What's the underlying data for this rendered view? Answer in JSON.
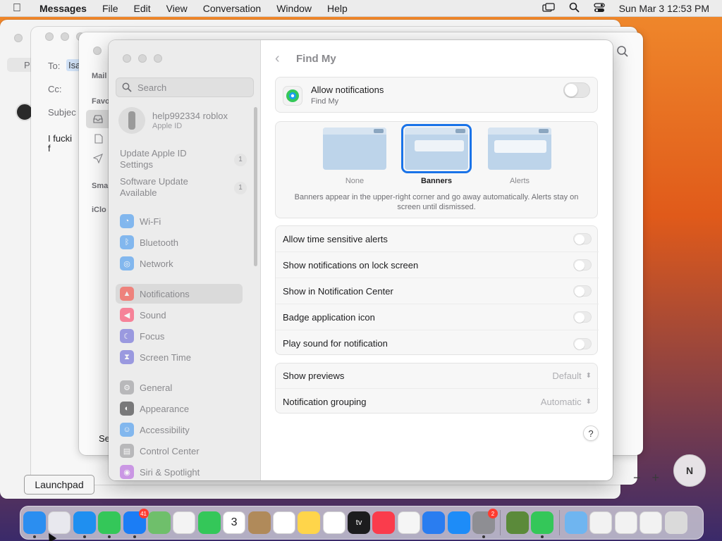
{
  "menubar": {
    "app_name": "Messages",
    "items": [
      "File",
      "Edit",
      "View",
      "Conversation",
      "Window",
      "Help"
    ],
    "clock": "Sun Mar 3  12:53 PM"
  },
  "background_messages": {
    "to_label": "To:",
    "to_value": "Isa",
    "cc_label": "Cc:",
    "subject_label": "Subjec",
    "body_text": "I fucki\nf",
    "mail_label": "Mail",
    "favorites_label": "Favo",
    "smart_label": "Sma",
    "icloud_label": "iClo",
    "send_label": "Se",
    "p_label": "P"
  },
  "sidebar": {
    "search_placeholder": "Search",
    "account": {
      "name": "help992334 roblox",
      "subtitle": "Apple ID"
    },
    "notices": [
      {
        "label": "Update Apple ID Settings",
        "count": "1"
      },
      {
        "label": "Software Update Available",
        "count": "1"
      }
    ],
    "items": [
      {
        "label": "Wi-Fi",
        "icon": "wifi-icon",
        "color": "#2d8cf0"
      },
      {
        "label": "Bluetooth",
        "icon": "bluetooth-icon",
        "color": "#2d8cf0"
      },
      {
        "label": "Network",
        "icon": "globe-icon",
        "color": "#2d8cf0"
      },
      {
        "label": "Notifications",
        "icon": "bell-icon",
        "color": "#ff3b30"
      },
      {
        "label": "Sound",
        "icon": "speaker-icon",
        "color": "#ff2d55"
      },
      {
        "label": "Focus",
        "icon": "moon-icon",
        "color": "#5856d6"
      },
      {
        "label": "Screen Time",
        "icon": "hourglass-icon",
        "color": "#5856d6"
      },
      {
        "label": "General",
        "icon": "gear-icon",
        "color": "#8e8e93"
      },
      {
        "label": "Appearance",
        "icon": "appearance-icon",
        "color": "#1c1c1e"
      },
      {
        "label": "Accessibility",
        "icon": "accessibility-icon",
        "color": "#2d8cf0"
      },
      {
        "label": "Control Center",
        "icon": "control-center-icon",
        "color": "#8e8e93"
      },
      {
        "label": "Siri & Spotlight",
        "icon": "siri-icon",
        "color": "#af52de"
      }
    ],
    "selected": "Notifications"
  },
  "pane": {
    "title": "Find My",
    "allow_notifications": {
      "label": "Allow notifications",
      "sub": "Find My",
      "enabled": false
    },
    "styles": [
      {
        "label": "None",
        "selected": false
      },
      {
        "label": "Banners",
        "selected": true
      },
      {
        "label": "Alerts",
        "selected": false
      }
    ],
    "style_description": "Banners appear in the upper-right corner and go away automatically. Alerts stay on screen until dismissed.",
    "toggles": [
      {
        "label": "Allow time sensitive alerts",
        "enabled": false
      },
      {
        "label": "Show notifications on lock screen",
        "enabled": false
      },
      {
        "label": "Show in Notification Center",
        "enabled": false
      },
      {
        "label": "Badge application icon",
        "enabled": false
      },
      {
        "label": "Play sound for notification",
        "enabled": false
      }
    ],
    "selects": [
      {
        "label": "Show previews",
        "value": "Default"
      },
      {
        "label": "Notification grouping",
        "value": "Automatic"
      }
    ],
    "help": "?"
  },
  "tooltip": "Launchpad",
  "map_controls": {
    "zoom_out": "−",
    "zoom_in": "+",
    "compass": "N"
  },
  "dock": {
    "apps": [
      {
        "name": "finder-icon",
        "color": "#2b8ef0",
        "dot": true
      },
      {
        "name": "launchpad-icon",
        "color": "#e8e8ee",
        "dot": false
      },
      {
        "name": "safari-icon",
        "color": "#1f8ff0",
        "dot": true
      },
      {
        "name": "messages-icon",
        "color": "#34c759",
        "dot": true
      },
      {
        "name": "mail-icon",
        "color": "#1b7df5",
        "dot": true,
        "badge": "41"
      },
      {
        "name": "maps-icon",
        "color": "#6fbf6b",
        "dot": false
      },
      {
        "name": "photos-icon",
        "color": "#f3f3f3",
        "dot": false
      },
      {
        "name": "facetime-icon",
        "color": "#34c759",
        "dot": false
      },
      {
        "name": "calendar-icon",
        "color": "#ffffff",
        "dot": false,
        "text": "3"
      },
      {
        "name": "contacts-icon",
        "color": "#b08a5a",
        "dot": false
      },
      {
        "name": "reminders-icon",
        "color": "#ffffff",
        "dot": false
      },
      {
        "name": "notes-icon",
        "color": "#ffd54a",
        "dot": false
      },
      {
        "name": "freeform-icon",
        "color": "#ffffff",
        "dot": false
      },
      {
        "name": "tv-icon",
        "color": "#1c1c1e",
        "dot": false,
        "text": "tv"
      },
      {
        "name": "music-icon",
        "color": "#fa3c4c",
        "dot": false
      },
      {
        "name": "news-icon",
        "color": "#f5f5f5",
        "dot": false
      },
      {
        "name": "keynote-icon",
        "color": "#2a7df0",
        "dot": false
      },
      {
        "name": "app-store-icon",
        "color": "#1d8cf8",
        "dot": false
      },
      {
        "name": "system-settings-icon",
        "color": "#8e8e93",
        "dot": true,
        "badge": "2"
      },
      {
        "name": "minecraft-icon",
        "color": "#5b8a3a",
        "dot": false
      },
      {
        "name": "find-my-icon",
        "color": "#34c759",
        "dot": true
      },
      {
        "name": "downloads-folder-icon",
        "color": "#6fb5f0",
        "dot": false
      },
      {
        "name": "window-thumbnail-1-icon",
        "color": "#f2f2f2",
        "dot": false
      },
      {
        "name": "window-thumbnail-2-icon",
        "color": "#f2f2f2",
        "dot": false
      },
      {
        "name": "window-thumbnail-3-icon",
        "color": "#f2f2f2",
        "dot": false
      },
      {
        "name": "trash-icon",
        "color": "#dadada",
        "dot": false
      }
    ]
  }
}
